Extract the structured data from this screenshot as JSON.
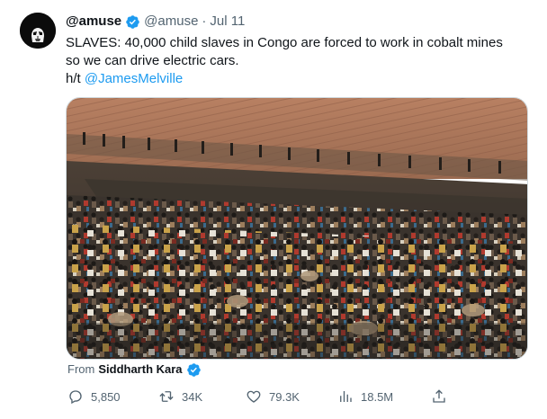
{
  "tweet": {
    "display_name": "@amuse",
    "handle": "@amuse",
    "separator": "·",
    "date": "Jul 11",
    "text_line1": "SLAVES: 40,000 child slaves in Congo are forced to work in cobalt mines",
    "text_line2": "so we can drive electric cars.",
    "hat_tip_prefix": "h/t ",
    "hat_tip_mention": "@JamesMelville"
  },
  "attribution": {
    "prefix": "From",
    "name": "Siddharth Kara"
  },
  "actions": {
    "replies": "5,850",
    "retweets": "34K",
    "likes": "79.3K",
    "views": "18.5M"
  },
  "icons": {
    "avatar": "stormtrooper-avatar-icon",
    "verified": "verified-badge-icon",
    "reply": "reply-icon",
    "retweet": "retweet-icon",
    "like": "heart-icon",
    "views": "views-chart-icon",
    "share": "share-icon"
  },
  "colors": {
    "accent": "#1d9bf0",
    "text": "#0f1419",
    "muted": "#536471"
  }
}
